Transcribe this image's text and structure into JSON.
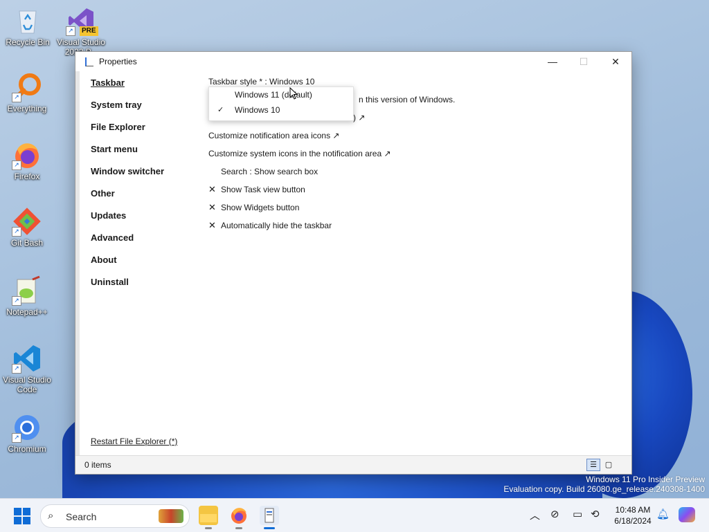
{
  "desktop": {
    "icons": [
      {
        "label": "Recycle Bin"
      },
      {
        "label": "Visual Studio 2022 P...",
        "badge": "PRE"
      },
      {
        "label": "Everything"
      },
      {
        "label": "Firefox"
      },
      {
        "label": "Git Bash"
      },
      {
        "label": "Notepad++"
      },
      {
        "label": "Visual Studio Code"
      },
      {
        "label": "Chromium"
      }
    ],
    "watermark_line1": "Windows 11 Pro Insider Preview",
    "watermark_line2": "Evaluation copy. Build 26080.ge_release.240308-1400"
  },
  "window": {
    "title": "Properties",
    "controls": {
      "minimize": "—",
      "maximize": "☐",
      "close": "✕"
    },
    "sidebar": {
      "items": [
        {
          "label": "Taskbar",
          "active": true
        },
        {
          "label": "System tray"
        },
        {
          "label": "File Explorer"
        },
        {
          "label": "Start menu"
        },
        {
          "label": "Window switcher"
        },
        {
          "label": "Other"
        },
        {
          "label": "Updates"
        },
        {
          "label": "Advanced"
        },
        {
          "label": "About"
        },
        {
          "label": "Uninstall"
        }
      ],
      "restart_label": "Restart File Explorer (*)"
    },
    "content": {
      "taskbar_style_label": "Taskbar style * : Windows 10",
      "hidden_text_1": "n this version of Windows.",
      "hidden_text_2": ") ↗",
      "rows": [
        {
          "mark": "",
          "label": "Customize notification area icons ↗"
        },
        {
          "mark": "",
          "label": "Customize system icons in the notification area ↗"
        },
        {
          "mark": "blank",
          "label": "Search : Show search box"
        },
        {
          "mark": "✕",
          "label": "Show Task view button"
        },
        {
          "mark": "✕",
          "label": "Show Widgets button"
        },
        {
          "mark": "✕",
          "label": "Automatically hide the taskbar"
        }
      ]
    },
    "dropdown": {
      "options": [
        {
          "label": "Windows 11 (default)",
          "checked": false
        },
        {
          "label": "Windows 10",
          "checked": true
        }
      ],
      "check_glyph": "✓"
    },
    "status": {
      "items_text": "0 items"
    }
  },
  "taskbar": {
    "search_placeholder": "Search",
    "clock_time": "10:48 AM",
    "clock_date": "6/18/2024",
    "tray_icons": [
      "chevron-up-icon",
      "network-off-icon",
      "display-icon",
      "sync-icon",
      "notification-bell-icon",
      "copilot-icon"
    ]
  }
}
